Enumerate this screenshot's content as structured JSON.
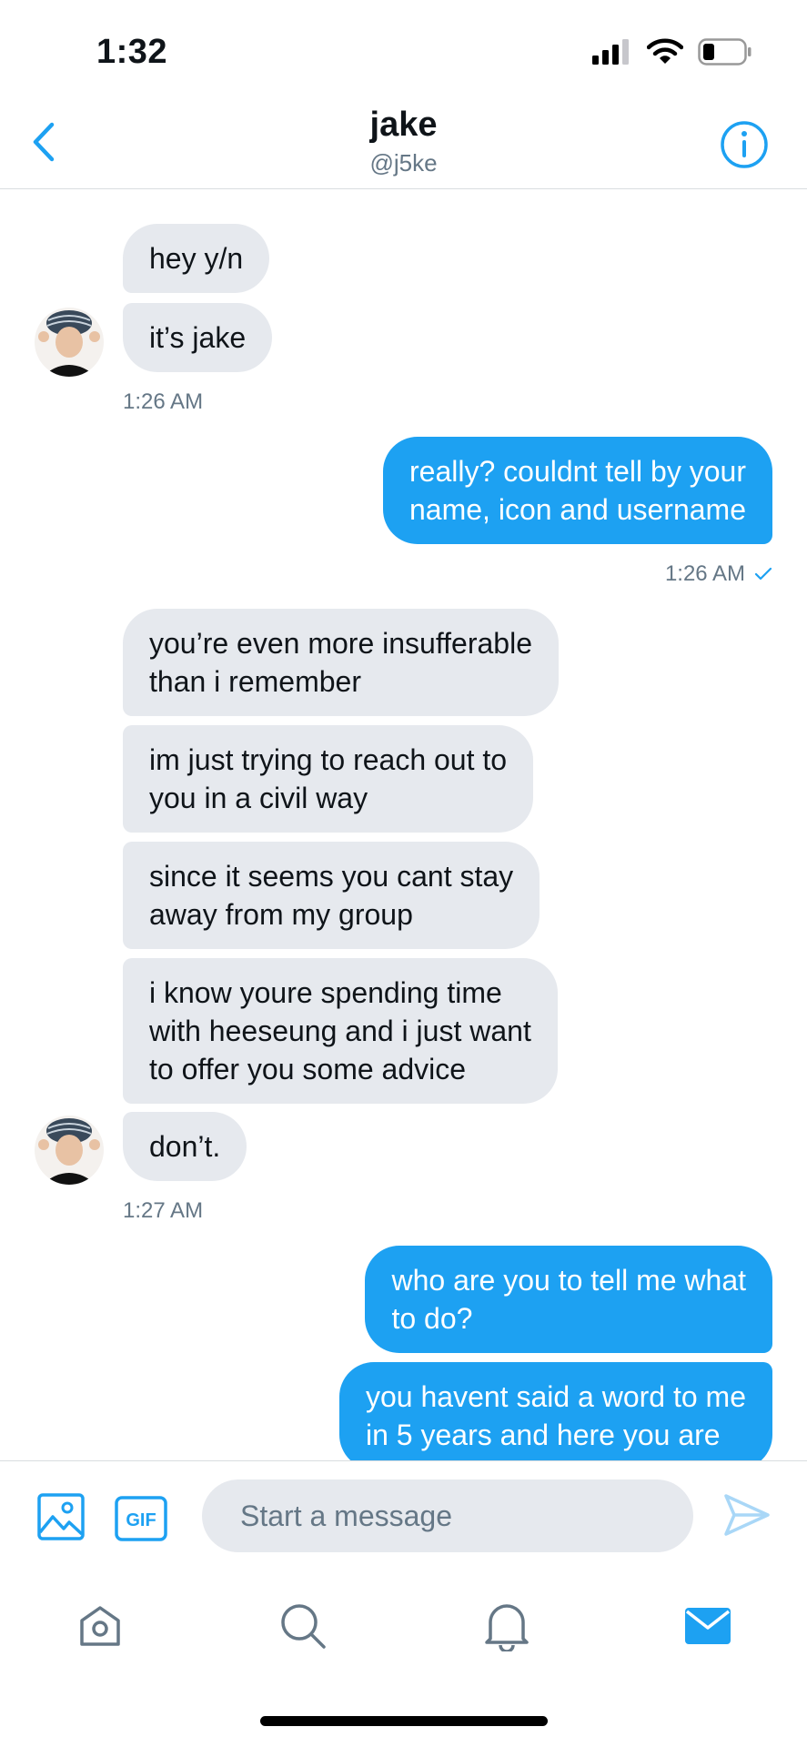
{
  "status_bar": {
    "time": "1:32"
  },
  "header": {
    "title": "jake",
    "handle": "@j5ke"
  },
  "messages": [
    {
      "text": "hey y/n"
    },
    {
      "text": "it’s jake"
    },
    {
      "time": "1:26 AM"
    },
    {
      "lines": [
        "really? couldnt tell by your",
        "name, icon and username"
      ]
    },
    {
      "time": "1:26 AM"
    },
    {
      "lines": [
        "you’re even more insufferable",
        "than i remember"
      ]
    },
    {
      "lines": [
        "im just trying to reach out to",
        "you in a civil way"
      ]
    },
    {
      "lines": [
        "since it seems you cant stay",
        "away from my group"
      ]
    },
    {
      "lines": [
        "i know youre spending time",
        "with heeseung and i just want",
        "to offer you some advice"
      ]
    },
    {
      "text": "don’t."
    },
    {
      "time": "1:27 AM"
    },
    {
      "lines": [
        "who are you to tell me what",
        "to do?"
      ]
    },
    {
      "lines": [
        "you havent said a word to me",
        "in 5 years and here you are"
      ]
    }
  ],
  "composer": {
    "placeholder": "Start a message",
    "gif_label": "GIF"
  },
  "icons": {
    "back": "chevron-left-icon",
    "info": "info-icon",
    "image": "image-icon",
    "gif": "gif-icon",
    "send": "send-icon",
    "home": "home-icon",
    "search": "search-icon",
    "notifications": "bell-icon",
    "messages": "mail-icon",
    "read_receipt": "check-icon"
  },
  "colors": {
    "accent": "#1da1f2",
    "incoming_bubble": "#e6e9ee",
    "muted": "#657786"
  }
}
